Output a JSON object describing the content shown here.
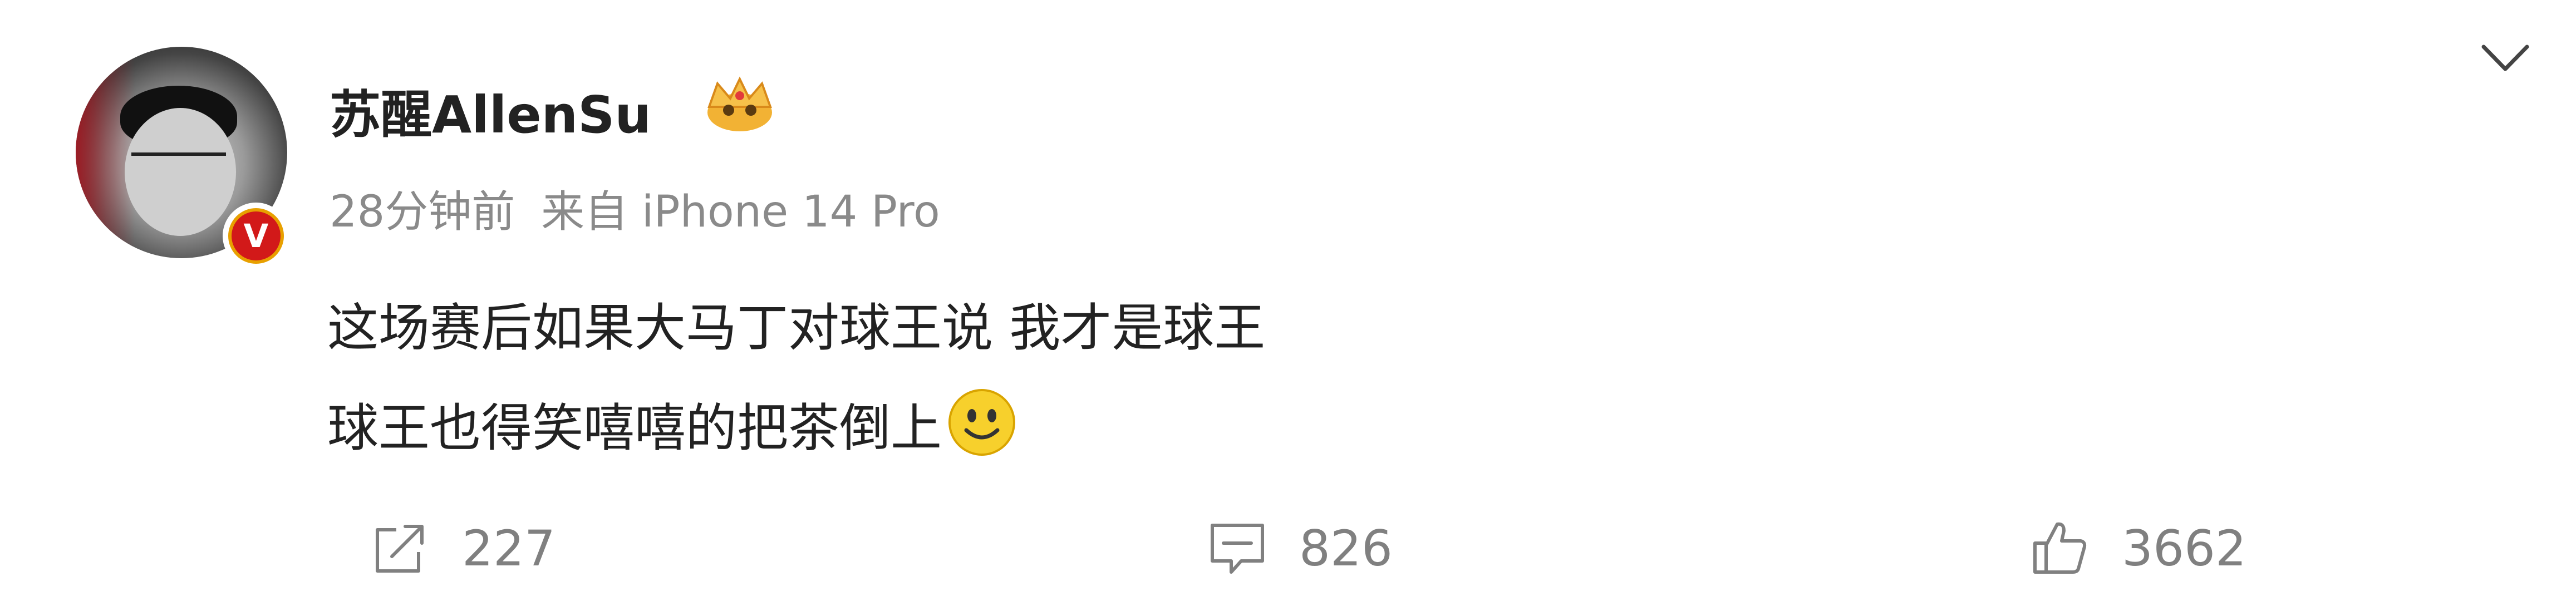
{
  "post": {
    "username": "苏醒AllenSu",
    "time": "28分钟前",
    "source": "来自 iPhone 14 Pro",
    "content_line1": "这场赛后如果大马丁对球王说 我才是球王",
    "content_line2": "球王也得笑嘻嘻的把茶倒上",
    "verified_badge": "V",
    "icons": {
      "more": "chevron-down-icon",
      "crown": "crown-icon",
      "emoji": "smile-emoji-icon"
    }
  },
  "actions": {
    "share_count": "227",
    "comment_count": "826",
    "like_count": "3662"
  },
  "colors": {
    "text": "#222222",
    "meta": "#8a8a8a",
    "verified": "#d21919",
    "badge_ring": "#e8a000"
  }
}
